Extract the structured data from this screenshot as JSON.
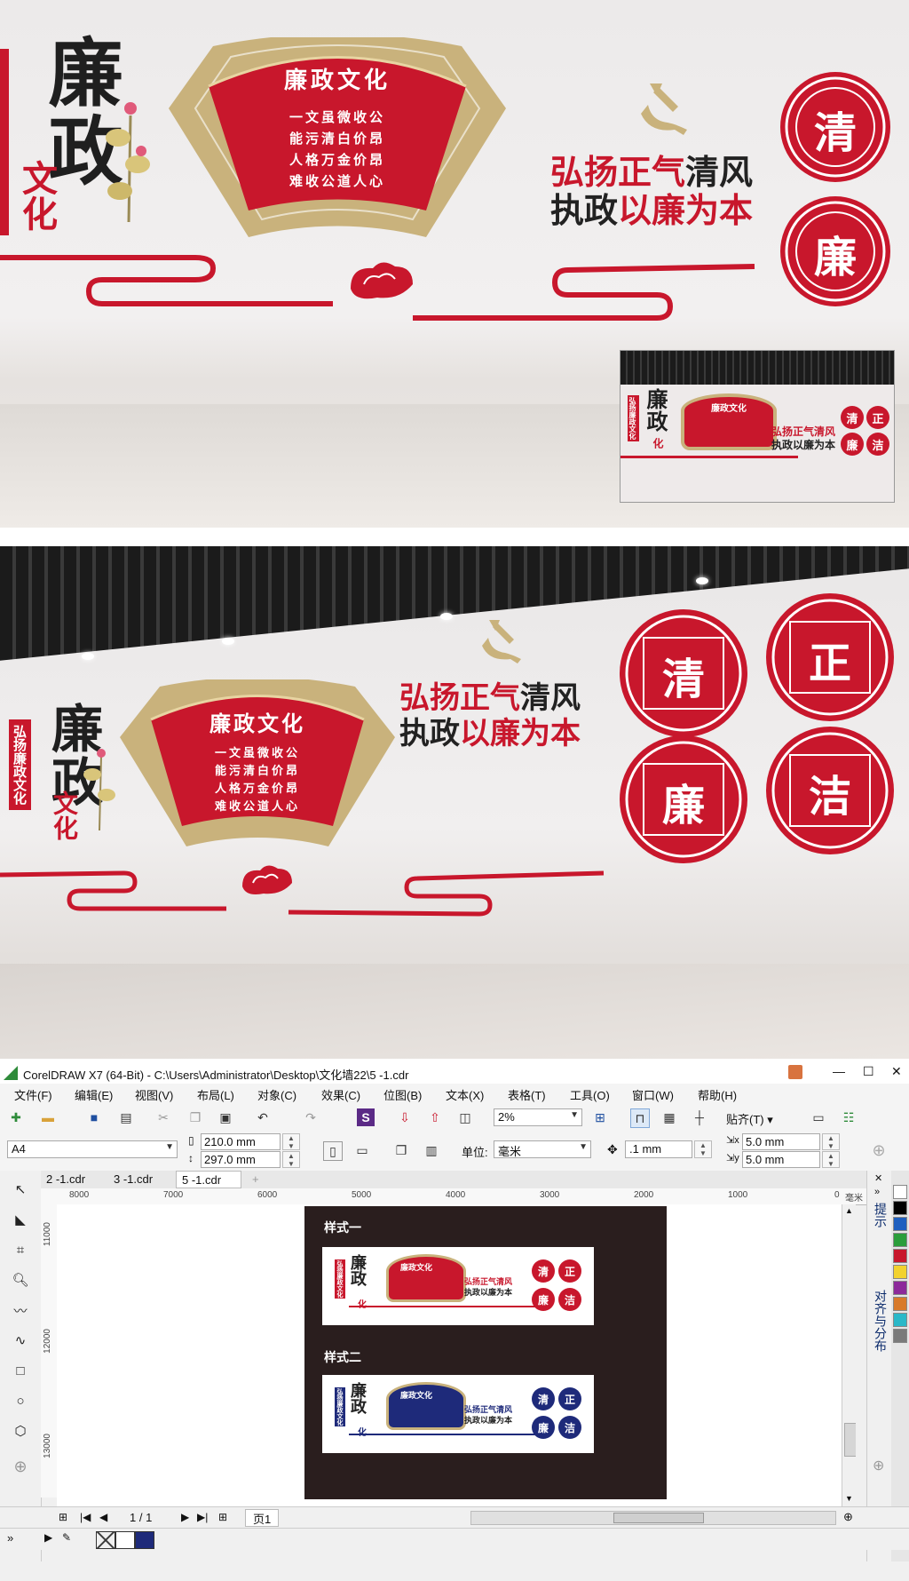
{
  "render_top": {
    "vertical_title": "廉政",
    "side_chars": "文化",
    "fan_title": "廉政文化",
    "poem_lines": [
      "一文虽微收公",
      "能污清白价昂",
      "人格万金价昂",
      "难收公道人心"
    ],
    "slogan_line1_red": "弘扬正气",
    "slogan_line1_black": "清风",
    "slogan_line2_black": "执政",
    "slogan_line2_red": "以廉为本",
    "discs": [
      "清",
      "廉"
    ],
    "inset": {
      "title": "廉政",
      "side": "化",
      "banner": "弘扬廉政文化",
      "fan_title": "廉政文化",
      "slogan_line1": "弘扬正气清风",
      "slogan_line2": "执政以廉为本",
      "discs": [
        "清",
        "正",
        "廉",
        "洁"
      ]
    }
  },
  "render_bottom": {
    "banner": "弘扬廉政文化",
    "vertical_title": "廉政",
    "side_chars": "文化",
    "fan_title": "廉政文化",
    "poem_lines": [
      "一文虽微收公",
      "能污清白价昂",
      "人格万金价昂",
      "难收公道人心"
    ],
    "slogan_line1_red": "弘扬正气",
    "slogan_line1_black": "清风",
    "slogan_line2_black": "执政",
    "slogan_line2_red": "以廉为本",
    "discs": [
      "清",
      "正",
      "廉",
      "洁"
    ]
  },
  "corel": {
    "window_title": "CorelDRAW X7 (64-Bit) - C:\\Users\\Administrator\\Desktop\\文化墙22\\5 -1.cdr",
    "window_buttons": [
      "—",
      "☐",
      "✕"
    ],
    "menu": [
      "文件(F)",
      "编辑(E)",
      "视图(V)",
      "布局(L)",
      "对象(C)",
      "效果(C)",
      "位图(B)",
      "文本(X)",
      "表格(T)",
      "工具(O)",
      "窗口(W)",
      "帮助(H)"
    ],
    "zoom": "2%",
    "snap_label": "贴齐(T)",
    "page_size": "A4",
    "width_value": "210.0 mm",
    "height_value": "297.0 mm",
    "unit_label": "单位:",
    "unit_value": "毫米",
    "nudge_value": ".1 mm",
    "dup_x": "5.0 mm",
    "dup_y": "5.0 mm",
    "tabs": [
      "2 -1.cdr",
      "3 -1.cdr",
      "5 -1.cdr"
    ],
    "active_tab": "5 -1.cdr",
    "ruler_h": [
      "8000",
      "7000",
      "6000",
      "5000",
      "4000",
      "3000",
      "2000",
      "1000",
      "0"
    ],
    "ruler_unit": "毫米",
    "ruler_v": [
      "11000",
      "12000",
      "13000"
    ],
    "docker_labels": [
      "提示",
      "对齐与分布"
    ],
    "style1_title": "样式一",
    "style2_title": "样式二",
    "thumb": {
      "title": "廉政",
      "side": "化",
      "banner": "弘扬廉政文化",
      "fan_title": "廉政文化",
      "slogan_line1": "弘扬正气清风",
      "slogan_line2": "执政以廉为本",
      "discs": [
        "清",
        "正",
        "廉",
        "洁"
      ]
    },
    "page_counter": "1 / 1",
    "page_tab": "页1",
    "colors": {
      "primary_red": "#c8172c",
      "navy": "#1e2a7a",
      "gold": "#c9b27c",
      "dark_panel": "#2a1e1e"
    }
  }
}
